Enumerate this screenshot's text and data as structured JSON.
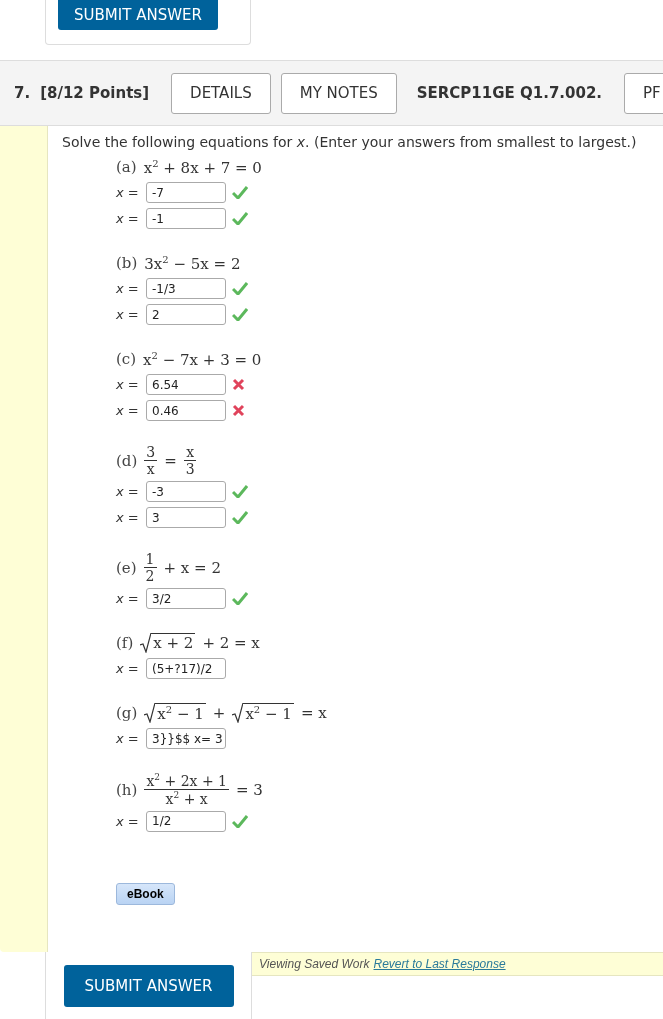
{
  "top_submit": {
    "label": "SUBMIT ANSWER"
  },
  "question": {
    "number": "7.",
    "points": "[8/12 Points]",
    "buttons": [
      "DETAILS",
      "MY NOTES"
    ],
    "code": "SERCP11GE Q1.7.002.",
    "cut_button": "PF",
    "prompt": "Solve the following equations for *x*. (Enter your answers from smallest to largest.)",
    "parts": [
      {
        "label": "(a)",
        "equation": [
          {
            "kind": "text",
            "text": "x$^{2}$ + 8x + 7 = 0"
          }
        ],
        "answers": [
          {
            "prefix": "*x* =",
            "value": "-7",
            "marked": true,
            "correct": true
          },
          {
            "prefix": "*x* =",
            "value": "-1",
            "marked": true,
            "correct": true
          }
        ]
      },
      {
        "label": "(b)",
        "equation": [
          {
            "kind": "text",
            "text": "3x$^{2}$ − 5x = 2"
          }
        ],
        "answers": [
          {
            "prefix": "*x* =",
            "value": "-1/3",
            "marked": true,
            "correct": true
          },
          {
            "prefix": "*x* =",
            "value": "2",
            "marked": true,
            "correct": true
          }
        ]
      },
      {
        "label": "(c)",
        "equation": [
          {
            "kind": "text",
            "text": "x$^{2}$ − 7x + 3 = 0"
          }
        ],
        "answers": [
          {
            "prefix": "*x* =",
            "value": "6.54",
            "marked": true,
            "correct": false
          },
          {
            "prefix": "*x* =",
            "value": "0.46",
            "marked": true,
            "correct": false
          }
        ]
      },
      {
        "label": "(d)",
        "equation": [
          {
            "kind": "frac",
            "num": "3",
            "den": "x"
          },
          {
            "kind": "text",
            "text": "="
          },
          {
            "kind": "frac",
            "num": "x",
            "den": "3"
          }
        ],
        "answers": [
          {
            "prefix": "*x* =",
            "value": "-3",
            "marked": true,
            "correct": true
          },
          {
            "prefix": "*x* =",
            "value": "3",
            "marked": true,
            "correct": true
          }
        ]
      },
      {
        "label": "(e)",
        "equation": [
          {
            "kind": "frac",
            "num": "1",
            "den": "2"
          },
          {
            "kind": "text",
            "text": "+ x = 2"
          }
        ],
        "answers": [
          {
            "prefix": "*x* =",
            "value": "3/2",
            "marked": true,
            "correct": true
          }
        ]
      },
      {
        "label": "(f)",
        "equation": [
          {
            "kind": "sqrt",
            "text": "x + 2"
          },
          {
            "kind": "text",
            "text": "+ 2 = x"
          }
        ],
        "answers": [
          {
            "prefix": "*x* =",
            "value": "(5+?17)/2",
            "marked": false
          }
        ]
      },
      {
        "label": "(g)",
        "equation": [
          {
            "kind": "sqrt",
            "text": "x$^{2}$ − 1"
          },
          {
            "kind": "text",
            "text": "+"
          },
          {
            "kind": "sqrt",
            "text": "x$^{2}$ − 1"
          },
          {
            "kind": "text",
            "text": "= x"
          }
        ],
        "answers": [
          {
            "prefix": "*x* =",
            "value": "3}}$$ x=  3",
            "marked": false
          }
        ]
      },
      {
        "label": "(h)",
        "equation": [
          {
            "kind": "frac",
            "num": "x$^{2}$ + 2x + 1",
            "den": "x$^{2}$ + x"
          },
          {
            "kind": "text",
            "text": "= 3"
          }
        ],
        "answers": [
          {
            "prefix": "*x* =",
            "value": "1/2",
            "marked": true,
            "correct": true
          }
        ]
      }
    ],
    "ebook": "eBook"
  },
  "footer": {
    "submit": "SUBMIT ANSWER",
    "notice": "Viewing Saved Work",
    "link": "Revert to Last Response"
  }
}
